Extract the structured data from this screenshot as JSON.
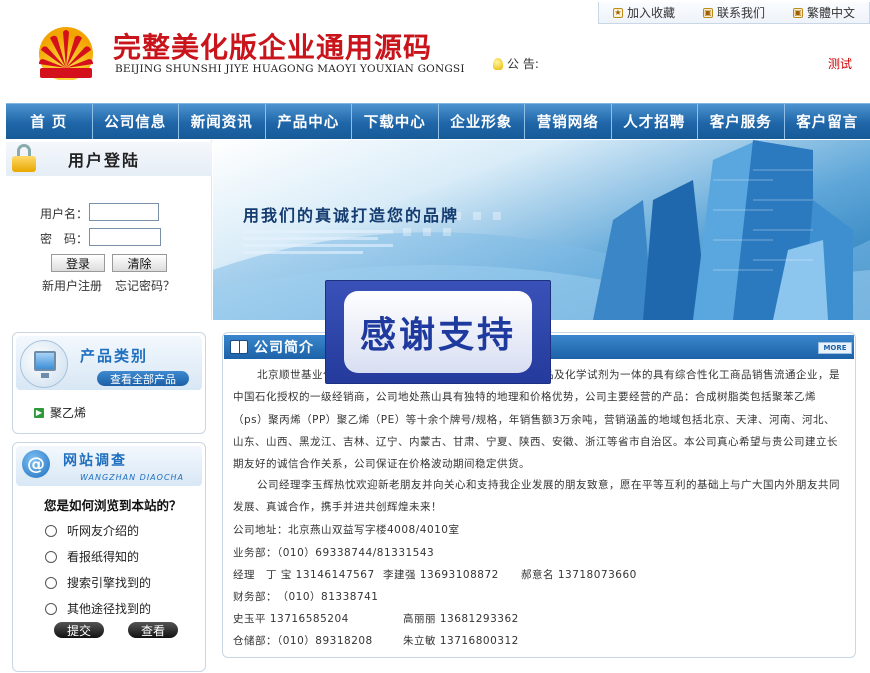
{
  "header": {
    "toplinks": [
      "加入收藏",
      "联系我们",
      "繁體中文"
    ],
    "title_cn": "完整美化版企业通用源码",
    "title_en": "BEIJING SHUNSHI JIYE HUAGONG MAOYI YOUXIAN GONGSI",
    "notice_label": "公 告:",
    "notice_link": "测试"
  },
  "nav": [
    "首 页",
    "公司信息",
    "新闻资讯",
    "产品中心",
    "下载中心",
    "企业形象",
    "营销网络",
    "人才招聘",
    "客户服务",
    "客户留言"
  ],
  "login": {
    "title": "用户登陆",
    "username_label": "用户名：",
    "password_label": "密　码：",
    "login_btn": "登录",
    "clear_btn": "清除",
    "register_link": "新用户注册",
    "forgot_link": "忘记密码？"
  },
  "banner": {
    "slogan": "用我们的真诚打造您的品牌"
  },
  "overlay": {
    "text": "感谢支持"
  },
  "category": {
    "title": "产品类别",
    "all_btn": "查看全部产品",
    "items": [
      "聚乙烯"
    ]
  },
  "survey": {
    "title": "网站调查",
    "subtitle": "WANGZHAN DIAOCHA",
    "question": "您是如何浏览到本站的？",
    "options": [
      "听网友介绍的",
      "看报纸得知的",
      "搜索引擎找到的",
      "其他途径找到的"
    ],
    "submit_btn": "提交",
    "view_btn": "查看"
  },
  "company": {
    "title": "公司简介",
    "more": "MORE",
    "para1": "北京顺世基业化工商贸有限公司是一家集化工原料、化工产品及化学试剂为一体的具有综合性化工商品销售流通企业，是中国石化授权的一级经销商，公司地处燕山具有独特的地理和价格优势，公司主要经营的产品：合成树脂类包括聚苯乙烯（ps）聚丙烯（PP）聚乙烯（PE）等十余个牌号/规格，年销售额3万余吨，营销涵盖的地域包括北京、天津、河南、河北、山东、山西、黑龙江、吉林、辽宁、内蒙古、甘肃、宁夏、陕西、安徽、浙江等省市自治区。本公司真心希望与贵公司建立长期友好的诚信合作关系，公司保证在价格波动期间稳定供货。",
    "para2": "公司经理李玉辉热忱欢迎新老朋友并向关心和支持我企业发展的朋友致意，愿在平等互利的基础上与广大国内外朋友共同发展、真诚合作，携手并进共创辉煌未来！",
    "address": "公司地址：北京燕山双益写字楼4008/4010室",
    "business": "业务部：（010）69338744/81331543",
    "contacts": [
      [
        "经理　丁 宝 13146147567",
        "李建强 13693108872",
        "郝意名 13718073660"
      ],
      [
        "财务部：　（010）81338741"
      ],
      [
        "史玉平 13716585204",
        "高丽丽 13681293362"
      ],
      [
        "仓储部：（010）89318208",
        "朱立敏 13716800312"
      ]
    ]
  },
  "colors": {
    "nav_blue": "#1f66a8",
    "title_red": "#c8141a",
    "accent_blue": "#1f6fc0"
  }
}
